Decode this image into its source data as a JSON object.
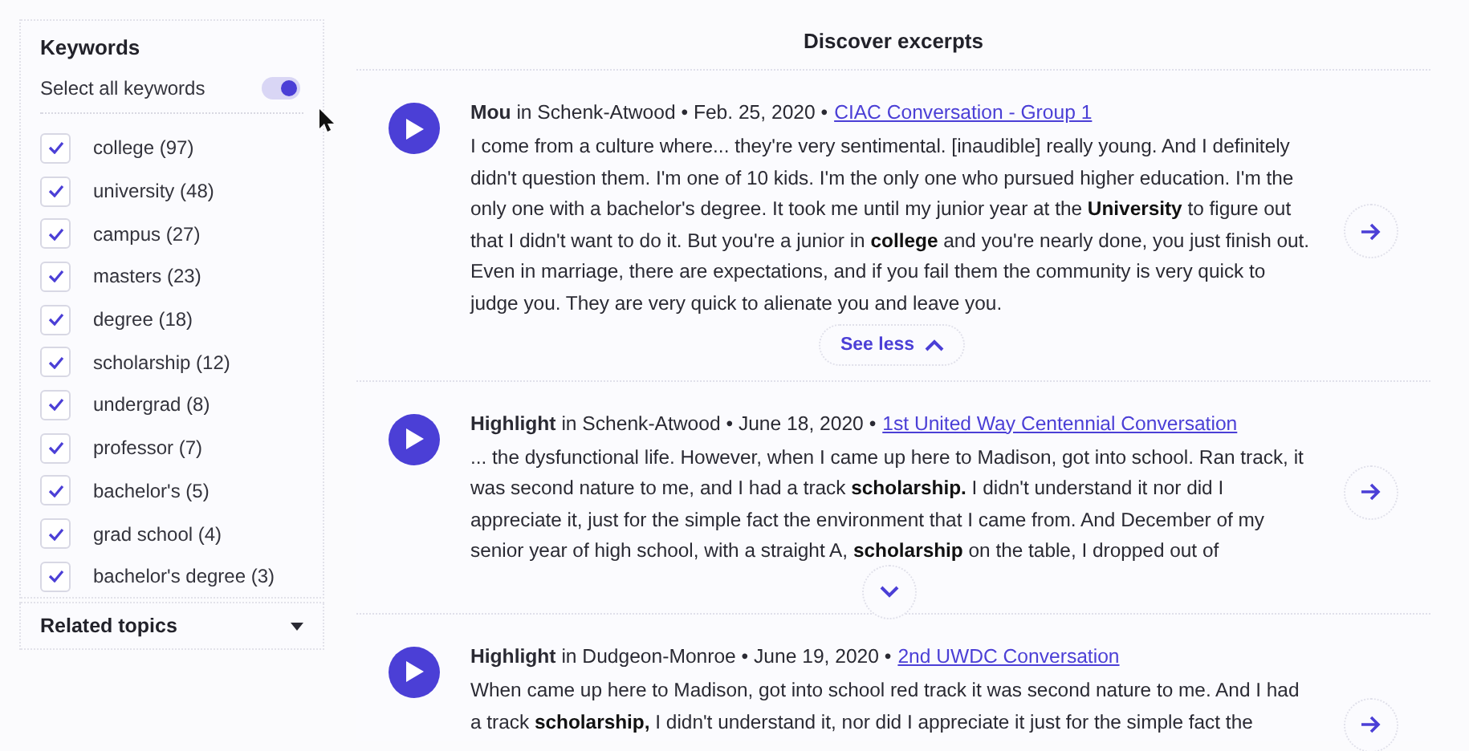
{
  "sidebar": {
    "keywords_panel": {
      "title": "Keywords",
      "select_all": {
        "label": "Select all keywords",
        "on": true
      },
      "items": [
        {
          "label": "college (97)",
          "checked": true
        },
        {
          "label": "university (48)",
          "checked": true
        },
        {
          "label": "campus (27)",
          "checked": true
        },
        {
          "label": "masters (23)",
          "checked": true
        },
        {
          "label": "degree (18)",
          "checked": true
        },
        {
          "label": "scholarship (12)",
          "checked": true
        },
        {
          "label": "undergrad (8)",
          "checked": true
        },
        {
          "label": "professor (7)",
          "checked": true
        },
        {
          "label": "bachelor's (5)",
          "checked": true
        },
        {
          "label": "grad school (4)",
          "checked": true
        },
        {
          "label": "bachelor's degree (3)",
          "checked": true
        }
      ]
    },
    "related_topics": {
      "label": "Related topics",
      "expanded": false
    }
  },
  "main": {
    "title": "Discover excerpts",
    "excerpts": [
      {
        "meta": "**Mou** in Schenk-Atwood • Feb. 25, 2020 •",
        "conversation": "CIAC Conversation - Group 1",
        "text": "I come from a culture where... they're very sentimental. [inaudible] really young. And I definitely didn't question them. I'm one of 10 kids. I'm the only one who pursued higher education. I'm the only one with a bachelor's degree. It took me until my junior year at the **University** to figure out that I didn't want to do it. But you're a junior in **college** and you're nearly done, you just finish out. Even in marriage, there are expectations, and if you fail them the community is very quick to judge you. They are very quick to alienate you and leave you.",
        "toggle": {
          "label": "See less",
          "expanded": true
        }
      },
      {
        "meta": "**Highlight** in Schenk-Atwood • June 18, 2020 •",
        "conversation": "1st United Way Centennial Conversation",
        "text": "... the dysfunctional life. However, when I came up here to Madison, got into school. Ran track, it was second nature to me, and I had a track **scholarship.** I didn't understand it nor did I appreciate it, just for the simple fact the environment that I came from. And December of my senior year of high school, with a straight A, **scholarship** on the table, I dropped out of",
        "toggle": {
          "expanded": false
        }
      },
      {
        "meta": "**Highlight** in Dudgeon-Monroe • June 19, 2020 •",
        "conversation": "2nd UWDC Conversation",
        "text": "When came up here to Madison, got into school red track it was second nature to me. And I had a track **scholarship,** I didn't understand it, nor did I appreciate it just for the simple fact the"
      }
    ]
  }
}
